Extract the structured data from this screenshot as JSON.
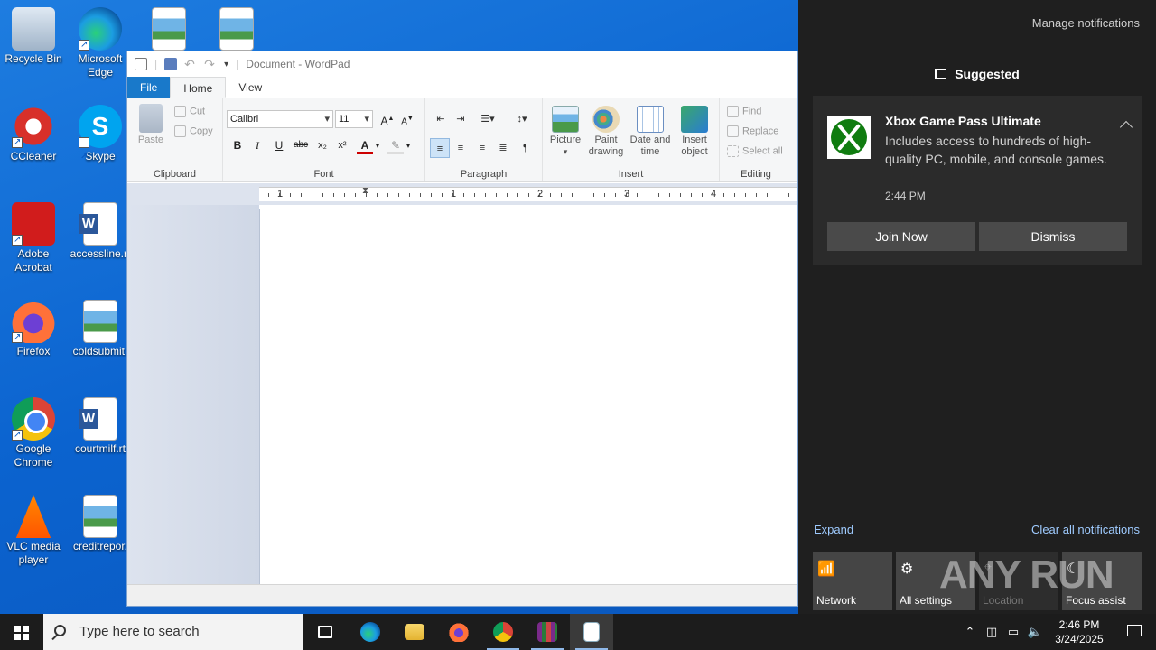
{
  "desktop": {
    "icons": [
      {
        "label": "Recycle Bin"
      },
      {
        "label": "Microsoft Edge"
      },
      {
        "label": "CCleaner"
      },
      {
        "label": "Skype"
      },
      {
        "label": "Adobe Acrobat"
      },
      {
        "label": "accessline.rt"
      },
      {
        "label": "Firefox"
      },
      {
        "label": "coldsubmit."
      },
      {
        "label": "Google Chrome"
      },
      {
        "label": "courtmilf.rt"
      },
      {
        "label": "VLC media player"
      },
      {
        "label": "creditrepor."
      }
    ]
  },
  "wordpad": {
    "title": "Document - WordPad",
    "tabs": [
      "File",
      "Home",
      "View"
    ],
    "clipboard": {
      "paste": "Paste",
      "cut": "Cut",
      "copy": "Copy",
      "group": "Clipboard"
    },
    "font": {
      "family": "Calibri",
      "size": "11",
      "group": "Font"
    },
    "paragraph": {
      "group": "Paragraph"
    },
    "insert": {
      "picture": "Picture",
      "paint": "Paint drawing",
      "datetime": "Date and time",
      "object": "Insert object",
      "group": "Insert"
    },
    "editing": {
      "find": "Find",
      "replace": "Replace",
      "select_all": "Select all",
      "group": "Editing"
    },
    "ruler_numbers": [
      "1",
      "1",
      "2",
      "3",
      "4"
    ]
  },
  "action_center": {
    "manage": "Manage notifications",
    "section": "Suggested",
    "toast": {
      "title": "Xbox Game Pass Ultimate",
      "body": "Includes access to hundreds of high-quality PC, mobile, and console games.",
      "time": "2:44 PM",
      "join": "Join Now",
      "dismiss": "Dismiss"
    },
    "expand": "Expand",
    "clear_all": "Clear all notifications",
    "quick_actions": [
      {
        "label": "Network"
      },
      {
        "label": "All settings"
      },
      {
        "label": "Location"
      },
      {
        "label": "Focus assist"
      }
    ],
    "watermark": "ANY RUN"
  },
  "taskbar": {
    "search_placeholder": "Type here to search",
    "time": "2:46 PM",
    "date": "3/24/2025"
  }
}
